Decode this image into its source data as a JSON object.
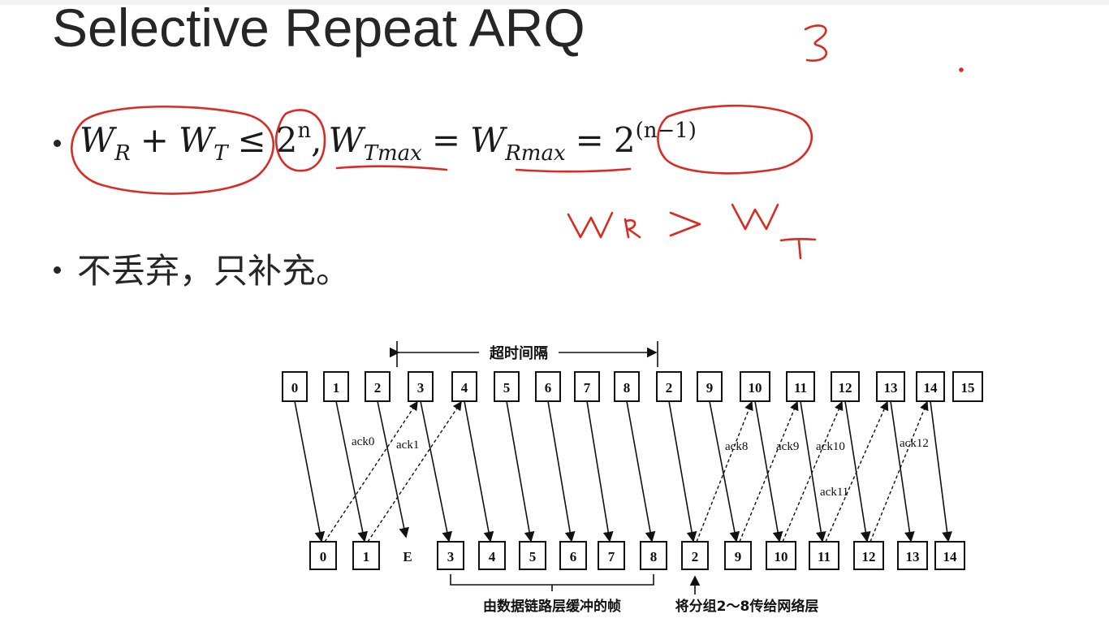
{
  "title": "Selective Repeat ARQ",
  "formula": {
    "w": "W",
    "sub_r": "R",
    "sub_t": "T",
    "plus": "+",
    "leq": "≤",
    "two": "2",
    "exp_n": "n",
    "comma": ",",
    "sub_tmax": "Tmax",
    "eq": "=",
    "sub_rmax": "Rmax",
    "exp_n_minus_1": "(n−1)"
  },
  "bullet2": "不丢弃，只补充。",
  "handwriting": {
    "number": "3",
    "relation": "W_R > W_T"
  },
  "diagram": {
    "timeout_label": "超时间隔",
    "sender_frames": [
      "0",
      "1",
      "2",
      "3",
      "4",
      "5",
      "6",
      "7",
      "8",
      "2",
      "9",
      "10",
      "11",
      "12",
      "13",
      "14",
      "15"
    ],
    "receiver_frames": [
      "0",
      "1",
      "E",
      "3",
      "4",
      "5",
      "6",
      "7",
      "8",
      "2",
      "9",
      "10",
      "11",
      "12",
      "13",
      "14"
    ],
    "acks": [
      "ack0",
      "ack1",
      "ack8",
      "ack9",
      "ack10",
      "ack11",
      "ack12"
    ],
    "buffer_label": "由数据链路层缓冲的帧",
    "deliver_label": "将分组2～8传给网络层"
  }
}
